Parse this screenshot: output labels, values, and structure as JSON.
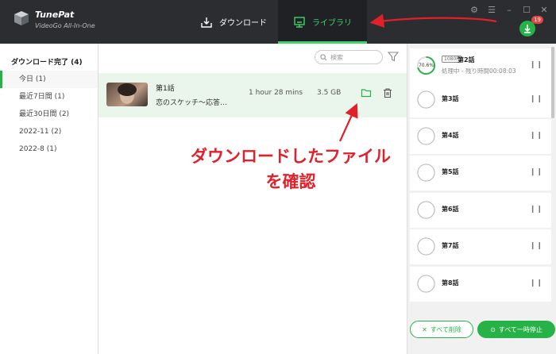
{
  "app": {
    "brand": "TunePat",
    "subtitle": "VideoGo All-In-One"
  },
  "tabs": {
    "download": "ダウンロード",
    "library": "ライブラリ"
  },
  "download_badge": {
    "count": "19"
  },
  "sidebar": {
    "title": "ダウンロード完了 (4)",
    "items": [
      {
        "label": "今日 (1)"
      },
      {
        "label": "最近7日間 (1)"
      },
      {
        "label": "最近30日間 (2)"
      },
      {
        "label": "2022-11 (2)"
      },
      {
        "label": "2022-8 (1)"
      }
    ]
  },
  "search": {
    "placeholder": "検索"
  },
  "library_item": {
    "title": "第1話",
    "subtitle": "恋のスケッチ～応答…",
    "duration": "1 hour 28 mins",
    "size": "3.5 GB"
  },
  "annotation": {
    "line1": "ダウンロードしたファイル",
    "line2": "を確認"
  },
  "queue": {
    "first": {
      "resolution": "1080P",
      "title": "第2話",
      "status": "処理中 - 残り時間00:08:03",
      "percent": "70.6%",
      "progress": 0.706
    },
    "items": [
      {
        "title": "第3話"
      },
      {
        "title": "第4話"
      },
      {
        "title": "第5話"
      },
      {
        "title": "第6話"
      },
      {
        "title": "第7話"
      },
      {
        "title": "第8話"
      }
    ],
    "delete_all": "すべて削除",
    "pause_all": "すべて一時停止"
  },
  "colors": {
    "accent": "#27b248",
    "annotation": "#e0202a",
    "topbar": "#2b2d31"
  }
}
